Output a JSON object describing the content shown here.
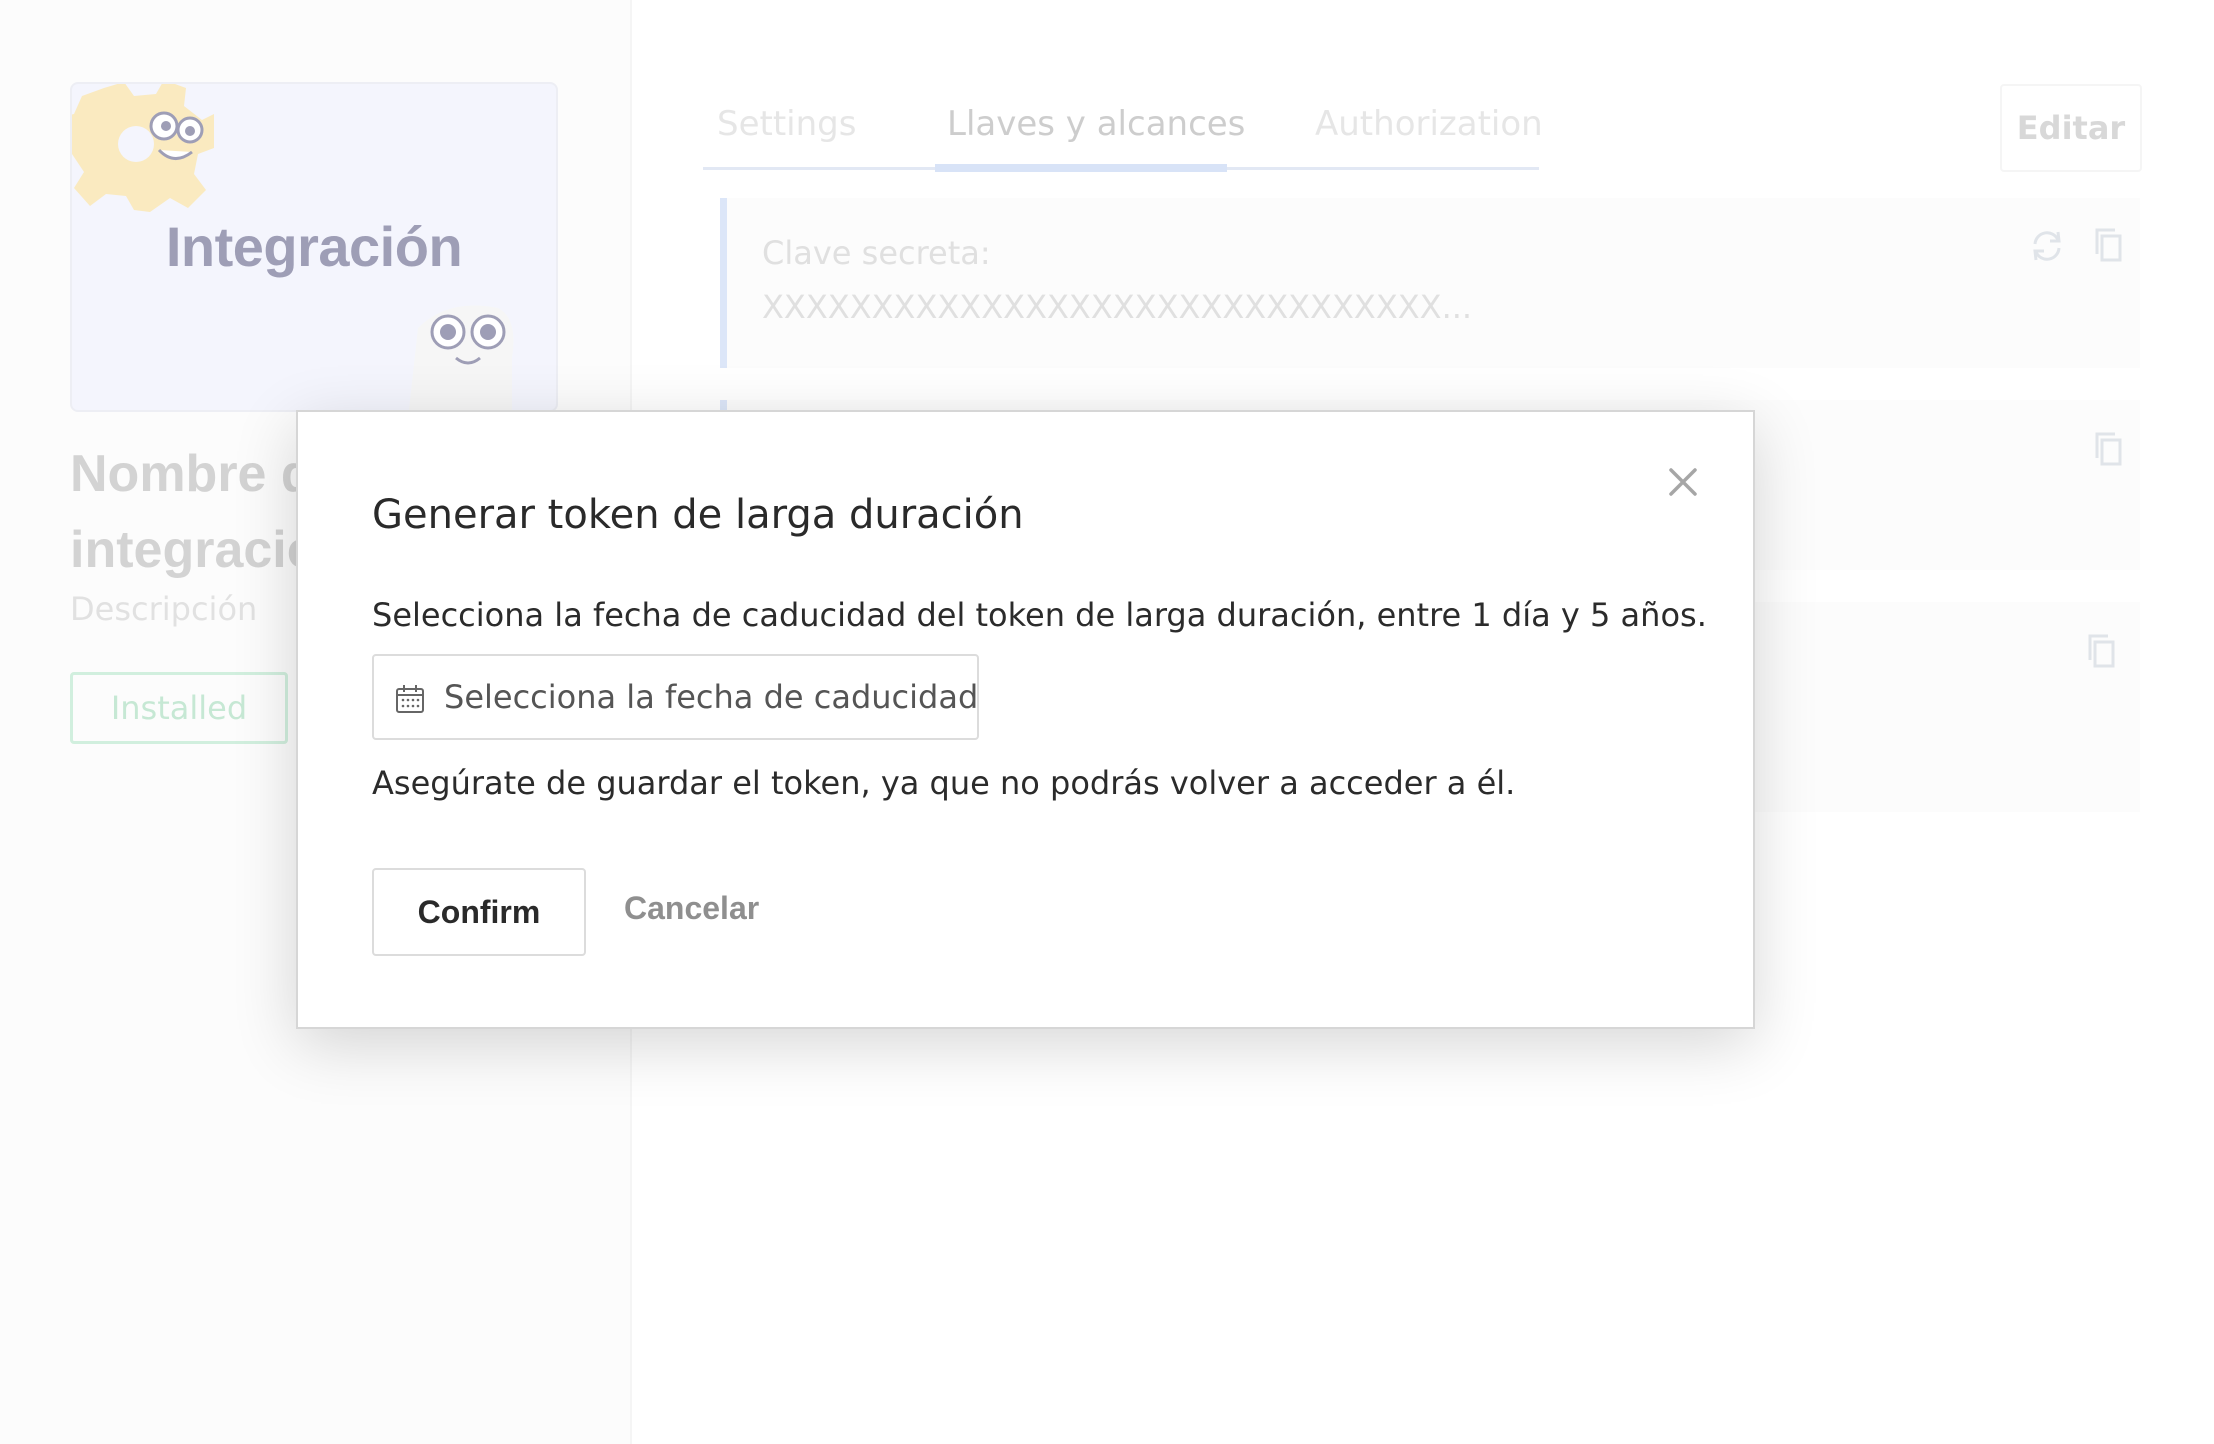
{
  "integration": {
    "logo_text": "Integración",
    "name": "Nombre de integración",
    "description": "Descripción",
    "status_badge": "Installed"
  },
  "tabs": [
    {
      "label": "Settings",
      "active": false
    },
    {
      "label": "Llaves y alcances",
      "active": true
    },
    {
      "label": "Authorization",
      "active": false
    }
  ],
  "toolbar": {
    "edit_label": "Editar"
  },
  "keys": [
    {
      "label": "Clave secreta:",
      "value": "XXXXXXXXXXXXXXXXXXXXXXXXXXXXXXX...",
      "icons": [
        "refresh-icon",
        "copy-icon"
      ]
    },
    {
      "label": "",
      "value": "",
      "icons": [
        "copy-icon"
      ]
    },
    {
      "label": "",
      "value": "",
      "icons": [
        "copy-icon"
      ]
    }
  ],
  "modal": {
    "title": "Generar token de larga duración",
    "description": "Selecciona la fecha de caducidad del token de larga duración, entre 1 día y 5 años.",
    "date_placeholder": "Selecciona la fecha de caducidad",
    "warning": "Asegúrate de guardar el token, ya que no podrás volver a acceder a él.",
    "confirm_label": "Confirm",
    "cancel_label": "Cancelar",
    "icons": {
      "close": "close-icon",
      "calendar": "calendar-icon"
    }
  },
  "colors": {
    "accent": "#c3d4f3",
    "installed_green": "#a8dcbd",
    "logo_text": "#6b6a8f",
    "gear_yellow": "#f7df9e"
  }
}
